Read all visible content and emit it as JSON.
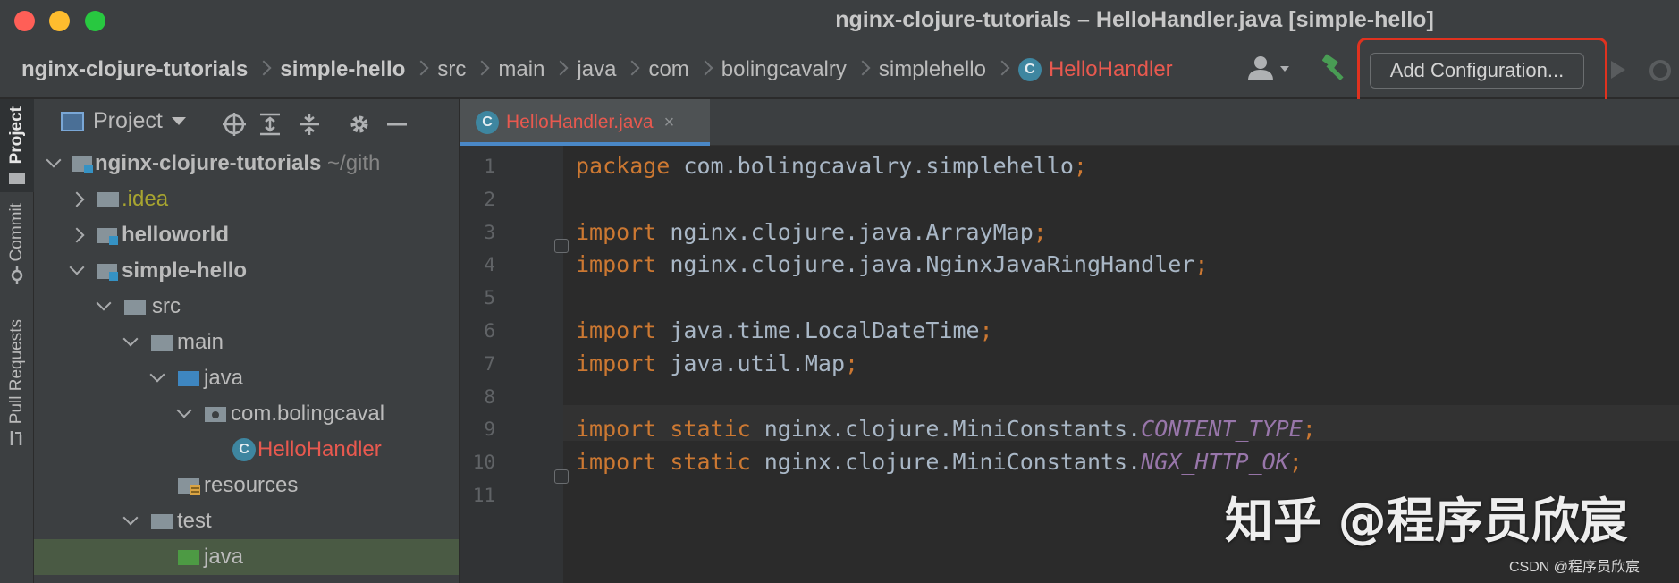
{
  "window": {
    "title": "nginx-clojure-tutorials – HelloHandler.java [simple-hello]"
  },
  "navbar": {
    "breadcrumbs": [
      {
        "label": "nginx-clojure-tutorials",
        "style": "bold"
      },
      {
        "label": "simple-hello",
        "style": "bold"
      },
      {
        "label": "src",
        "style": "normal"
      },
      {
        "label": "main",
        "style": "normal"
      },
      {
        "label": "java",
        "style": "normal"
      },
      {
        "label": "com",
        "style": "normal"
      },
      {
        "label": "bolingcavalry",
        "style": "normal"
      },
      {
        "label": "simplehello",
        "style": "normal"
      },
      {
        "label": "HelloHandler",
        "style": "active",
        "icon": "class-icon"
      }
    ],
    "class_badge": "C",
    "add_configuration_label": "Add Configuration..."
  },
  "toolstrip": {
    "project_label": "Project",
    "commit_label": "Commit",
    "pull_requests_label": "Pull Requests"
  },
  "project_panel": {
    "title": "Project",
    "tree": [
      {
        "label": "nginx-clojure-tutorials",
        "suffix": " ~/gith",
        "depth": 0,
        "expanded": true,
        "icon": "module-folder-icon",
        "style": "bold"
      },
      {
        "label": ".idea",
        "depth": 1,
        "expanded": false,
        "icon": "folder-icon",
        "style": "yellowish"
      },
      {
        "label": "helloworld",
        "depth": 1,
        "expanded": false,
        "icon": "module-folder-icon",
        "style": "bold"
      },
      {
        "label": "simple-hello",
        "depth": 1,
        "expanded": true,
        "icon": "module-folder-icon",
        "style": "bold"
      },
      {
        "label": "src",
        "depth": 2,
        "expanded": true,
        "icon": "folder-icon",
        "style": "normal"
      },
      {
        "label": "main",
        "depth": 3,
        "expanded": true,
        "icon": "folder-icon",
        "style": "normal"
      },
      {
        "label": "java",
        "depth": 4,
        "expanded": true,
        "icon": "source-folder-icon",
        "style": "normal"
      },
      {
        "label": "com.bolingcaval",
        "depth": 5,
        "expanded": true,
        "icon": "package-icon",
        "style": "normal"
      },
      {
        "label": "HelloHandler",
        "depth": 6,
        "icon": "class-icon",
        "style": "red"
      },
      {
        "label": "resources",
        "depth": 4,
        "icon": "resources-folder-icon",
        "style": "normal"
      },
      {
        "label": "test",
        "depth": 3,
        "expanded": true,
        "icon": "folder-icon",
        "style": "normal"
      },
      {
        "label": "java",
        "depth": 4,
        "icon": "test-source-folder-icon",
        "style": "normal",
        "selected": true
      }
    ]
  },
  "editor": {
    "tab_label": "HelloHandler.java",
    "tab_close": "×",
    "current_line": 5,
    "lines": [
      {
        "n": "1",
        "parts": [
          [
            "kw",
            "package"
          ],
          [
            "txt",
            " com.bolingcavalry.simplehello"
          ],
          [
            "kw",
            ";"
          ]
        ]
      },
      {
        "n": "2",
        "parts": []
      },
      {
        "n": "3",
        "parts": [
          [
            "kw",
            "import"
          ],
          [
            "txt",
            " nginx.clojure.java.ArrayMap"
          ],
          [
            "kw",
            ";"
          ]
        ]
      },
      {
        "n": "4",
        "parts": [
          [
            "kw",
            "import"
          ],
          [
            "txt",
            " nginx.clojure.java.NginxJavaRingHandler"
          ],
          [
            "kw",
            ";"
          ]
        ]
      },
      {
        "n": "5",
        "parts": []
      },
      {
        "n": "6",
        "parts": [
          [
            "kw",
            "import"
          ],
          [
            "txt",
            " java.time.LocalDateTime"
          ],
          [
            "kw",
            ";"
          ]
        ]
      },
      {
        "n": "7",
        "parts": [
          [
            "kw",
            "import"
          ],
          [
            "txt",
            " java.util.Map"
          ],
          [
            "kw",
            ";"
          ]
        ]
      },
      {
        "n": "8",
        "parts": []
      },
      {
        "n": "9",
        "parts": [
          [
            "kw",
            "import static"
          ],
          [
            "txt",
            " nginx.clojure.MiniConstants."
          ],
          [
            "const",
            "CONTENT_TYPE"
          ],
          [
            "kw",
            ";"
          ]
        ]
      },
      {
        "n": "10",
        "parts": [
          [
            "kw",
            "import static"
          ],
          [
            "txt",
            " nginx.clojure.MiniConstants."
          ],
          [
            "const",
            "NGX_HTTP_OK"
          ],
          [
            "kw",
            ";"
          ]
        ]
      },
      {
        "n": "11",
        "parts": []
      }
    ]
  },
  "watermark": {
    "text": "知乎 @程序员欣宸",
    "credit": "CSDN @程序员欣宸"
  },
  "colors": {
    "highlight_box": "#e0321f",
    "keyword": "#cc7832",
    "constant": "#9876aa",
    "active_file": "#e8594f"
  }
}
